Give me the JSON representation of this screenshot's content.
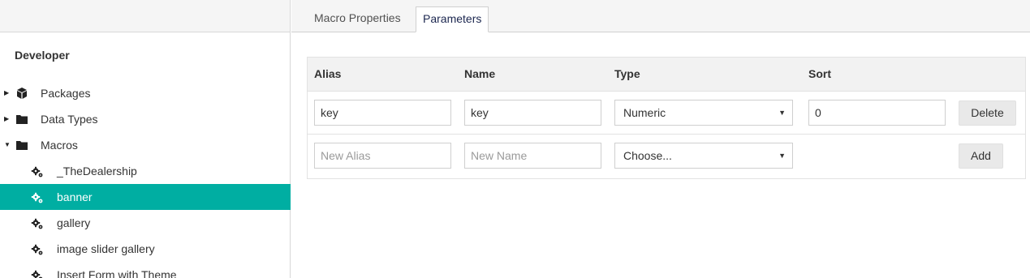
{
  "sidebar": {
    "heading": "Developer",
    "items": [
      {
        "label": "Packages",
        "level": 1,
        "expanded": false,
        "icon": "package-icon"
      },
      {
        "label": "Data Types",
        "level": 1,
        "expanded": false,
        "icon": "folder-icon"
      },
      {
        "label": "Macros",
        "level": 1,
        "expanded": true,
        "icon": "folder-icon"
      },
      {
        "label": "_TheDealership",
        "level": 2,
        "icon": "gears-icon"
      },
      {
        "label": "banner",
        "level": 2,
        "icon": "gears-icon",
        "active": true
      },
      {
        "label": "gallery",
        "level": 2,
        "icon": "gears-icon"
      },
      {
        "label": "image slider gallery",
        "level": 2,
        "icon": "gears-icon"
      },
      {
        "label": "Insert Form with Theme",
        "level": 2,
        "icon": "gears-icon"
      }
    ]
  },
  "tabs": [
    {
      "label": "Macro Properties",
      "active": false
    },
    {
      "label": "Parameters",
      "active": true
    }
  ],
  "parameters": {
    "headers": {
      "alias": "Alias",
      "name": "Name",
      "type": "Type",
      "sort": "Sort"
    },
    "rows": [
      {
        "alias": "key",
        "name": "key",
        "type": "Numeric",
        "sort": "0",
        "action": "Delete"
      }
    ],
    "new_row": {
      "alias_placeholder": "New Alias",
      "name_placeholder": "New Name",
      "type": "Choose...",
      "action": "Add"
    }
  },
  "colors": {
    "accent": "#00aea2",
    "active_tab_text": "#1b264f",
    "header_bg": "#f2f2f2"
  }
}
